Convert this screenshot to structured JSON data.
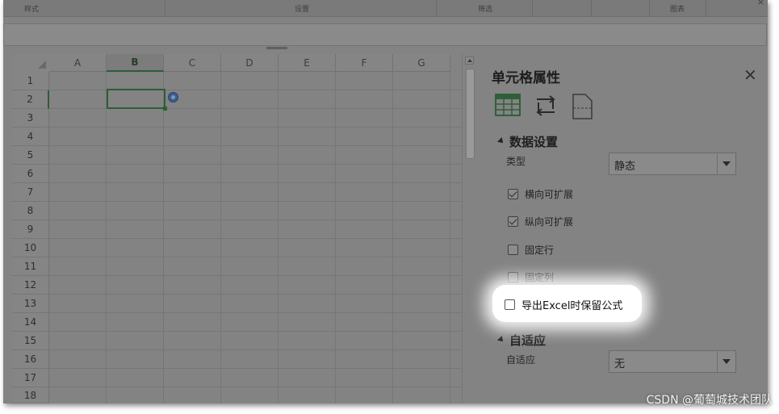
{
  "ribbon": {
    "groups": [
      "样式",
      "设置",
      "筛选",
      "图表"
    ]
  },
  "grid": {
    "columns": [
      "A",
      "B",
      "C",
      "D",
      "E",
      "F",
      "G"
    ],
    "rows": [
      "1",
      "2",
      "3",
      "4",
      "5",
      "6",
      "7",
      "8",
      "9",
      "10",
      "11",
      "12",
      "13",
      "14",
      "15",
      "16",
      "17",
      "18"
    ],
    "selected_column": "B",
    "selected_row": "2"
  },
  "panel": {
    "title": "单元格属性",
    "icons": [
      "cell-grid-icon",
      "transpose-icon",
      "page-icon"
    ],
    "data_section": {
      "heading": "数据设置",
      "type_label": "类型",
      "type_value": "静态",
      "checkboxes": [
        {
          "label": "横向可扩展",
          "checked": true
        },
        {
          "label": "纵向可扩展",
          "checked": true
        },
        {
          "label": "固定行",
          "checked": false
        },
        {
          "label": "固定列",
          "checked": false
        }
      ],
      "export_formula": {
        "label": "导出Excel时保留公式",
        "checked": false
      }
    },
    "adapt_section": {
      "heading": "自适应",
      "adapt_label": "自适应",
      "adapt_value": "无"
    }
  },
  "watermark": "CSDN @葡萄城技术团队"
}
